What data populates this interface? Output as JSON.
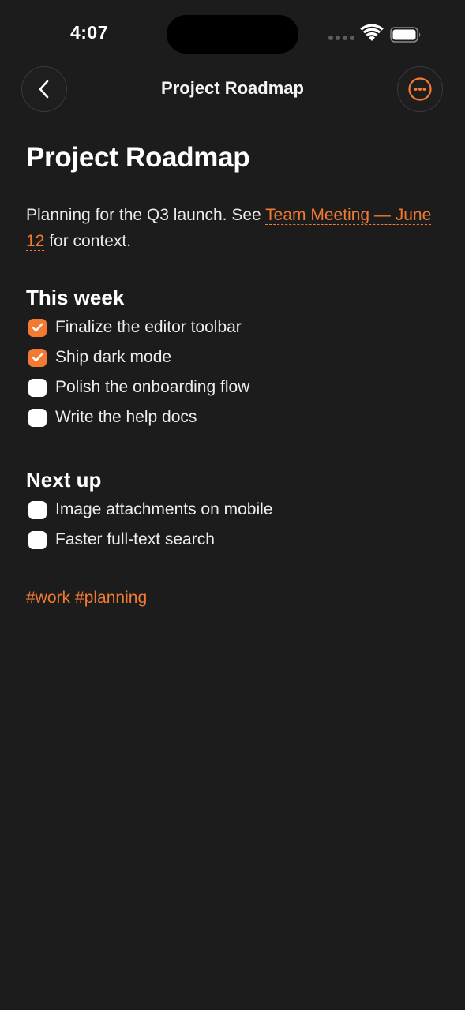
{
  "status_bar": {
    "time": "4:07"
  },
  "nav": {
    "title": "Project Roadmap",
    "back_icon": "chevron-left-icon",
    "more_icon": "ellipsis-circle-icon"
  },
  "note": {
    "title": "Project Roadmap",
    "intro_before": "Planning for the Q3 launch. See ",
    "intro_link": "Team Meeting — June 12",
    "intro_after": " for context.",
    "sections": [
      {
        "heading": "This week",
        "tasks": [
          {
            "label": "Finalize the editor toolbar",
            "checked": true
          },
          {
            "label": "Ship dark mode",
            "checked": true
          },
          {
            "label": "Polish the onboarding flow",
            "checked": false
          },
          {
            "label": "Write the help docs",
            "checked": false
          }
        ]
      },
      {
        "heading": "Next up",
        "tasks": [
          {
            "label": "Image attachments on mobile",
            "checked": false
          },
          {
            "label": "Faster full-text search",
            "checked": false
          }
        ]
      }
    ],
    "tags": [
      "#work",
      "#planning"
    ]
  },
  "colors": {
    "background": "#1c1c1c",
    "accent": "#f27a33",
    "text": "#ffffff"
  }
}
